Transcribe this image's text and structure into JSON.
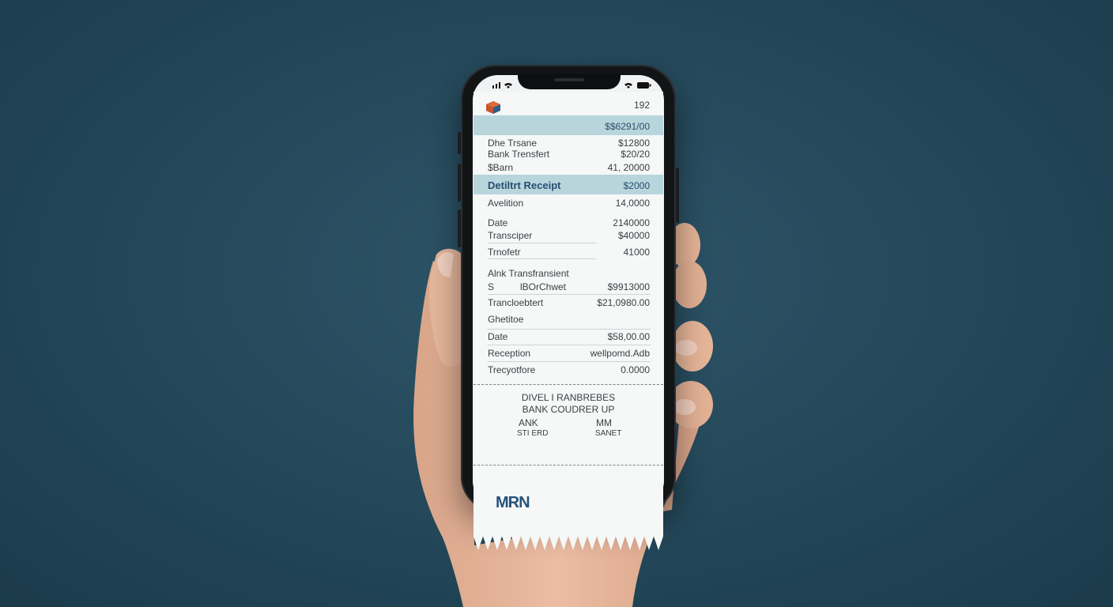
{
  "colors": {
    "background": "#254a5c",
    "band": "#b8d5dc",
    "brand": "#24527a",
    "skin": "#e2b197"
  },
  "phone": {
    "status_bar": {
      "signal_icon": "signal-bars-icon",
      "wifi_icon": "wifi-icon",
      "battery_icon": "battery-icon"
    }
  },
  "receipt": {
    "header": {
      "logo_icon": "hexagon-logo-icon",
      "number": "192"
    },
    "top_band": {
      "amount": "$$6291/00"
    },
    "rows_a": [
      {
        "label": "Dhe Trsane",
        "value": "$12800"
      },
      {
        "label": "Bank Trensfert",
        "value": "$20/20"
      },
      {
        "label": "$Barn",
        "value": "41, 20000"
      }
    ],
    "section_band": {
      "title": "Detiltrt Receipt",
      "amount": "$2000"
    },
    "rows_b": [
      {
        "label": "Avelition",
        "value": "14,0000"
      },
      {
        "label": "Date",
        "value": "2140000"
      },
      {
        "label": "Transciper",
        "value": "$40000"
      },
      {
        "label": "Trnofetr",
        "value": "41000"
      }
    ],
    "transfer_heading": "Alnk Transfransient",
    "rows_c": [
      {
        "label": "S",
        "label2": "lBOrChwet",
        "value": "$9913000"
      },
      {
        "label": "Trancloebtert",
        "value": "$21,0980.00"
      },
      {
        "label": "Ghetitoe",
        "value": ""
      },
      {
        "label": "Date",
        "value": "$58,00.00"
      },
      {
        "label": "Reception",
        "value": "wellpomd.Adb"
      },
      {
        "label": "Trecyotfore",
        "value": "0.0000"
      }
    ],
    "footer": {
      "line1": "DIVEL I RANBREBES",
      "line2": "BANK COUDRER UP",
      "left_top": "ANK",
      "left_bottom": "STI ERD",
      "right_top": "MM",
      "right_bottom": "SANET"
    },
    "brand": "MRN"
  }
}
